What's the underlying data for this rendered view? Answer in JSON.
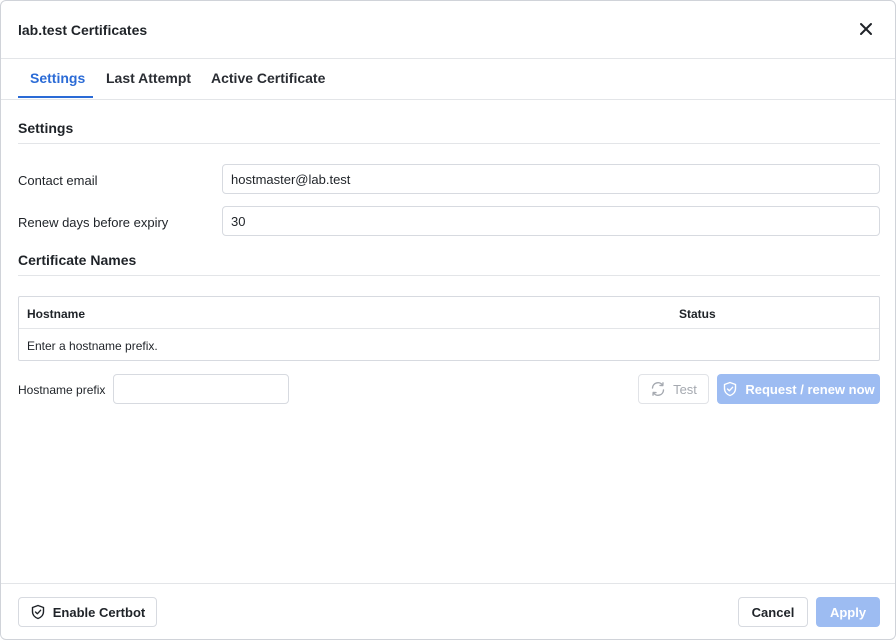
{
  "dialog": {
    "title": "lab.test Certificates"
  },
  "tabs": [
    {
      "label": "Settings",
      "active": true
    },
    {
      "label": "Last Attempt",
      "active": false
    },
    {
      "label": "Active Certificate",
      "active": false
    }
  ],
  "settings": {
    "heading": "Settings",
    "contact_email_label": "Contact email",
    "contact_email_value": "hostmaster@lab.test",
    "renew_days_label": "Renew days before expiry",
    "renew_days_value": "30"
  },
  "names": {
    "heading": "Certificate Names",
    "columns": [
      "Hostname",
      "Status"
    ],
    "empty_message": "Enter a hostname prefix.",
    "prefix_label": "Hostname prefix",
    "prefix_value": ""
  },
  "actions": {
    "test_label": "Test",
    "request_label": "Request / renew now"
  },
  "footer": {
    "enable_label": "Enable Certbot",
    "cancel_label": "Cancel",
    "apply_label": "Apply"
  },
  "colors": {
    "accent": "#2b6bd6",
    "primary_disabled": "#9dbcf2",
    "border": "#d7dae0"
  },
  "icons": {
    "close": "close-icon",
    "test": "refresh-icon",
    "request": "shield-check-icon",
    "enable": "shield-check-icon"
  }
}
